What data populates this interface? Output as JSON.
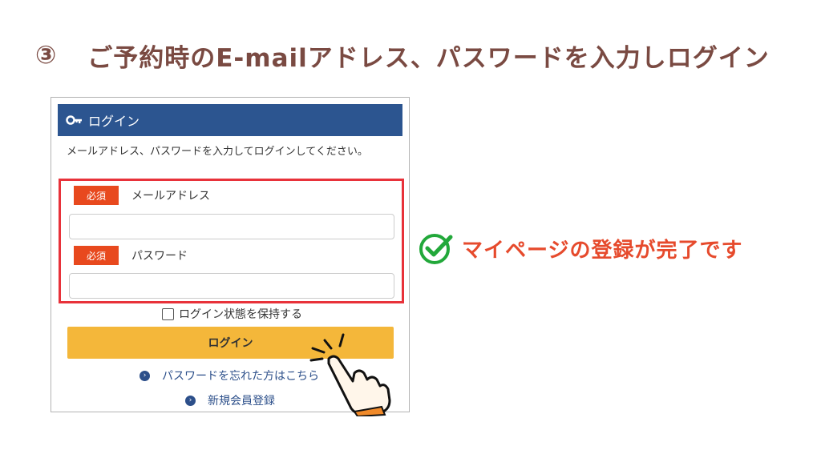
{
  "heading": {
    "step_number": "③",
    "text": "ご予約時のE-mailアドレス、パスワードを入力しログイン"
  },
  "panel": {
    "title": "ログイン",
    "intro": "メールアドレス、パスワードを入力してログインしてください。",
    "fields": [
      {
        "badge": "必須",
        "label": "メールアドレス",
        "value": ""
      },
      {
        "badge": "必須",
        "label": "パスワード",
        "value": ""
      }
    ],
    "remember_label": "ログイン状態を保持する",
    "login_button": "ログイン",
    "links": [
      {
        "label": "パスワードを忘れた方はこちら"
      },
      {
        "label": "新規会員登録"
      }
    ]
  },
  "callout": {
    "text": "マイページの登録が完了です"
  },
  "colors": {
    "header_bg": "#2c5590",
    "login_button_bg": "#f4b73a",
    "badge_bg": "#e8491e",
    "highlight_border": "#e8323a",
    "callout_text": "#e64a2c",
    "check_green": "#22a83a",
    "heading_text": "#7a4a42"
  },
  "icons": {
    "header": "key-icon",
    "links": "circle-arrow-icon",
    "pointer": "pointing-hand-icon",
    "callout": "check-circle-icon"
  }
}
